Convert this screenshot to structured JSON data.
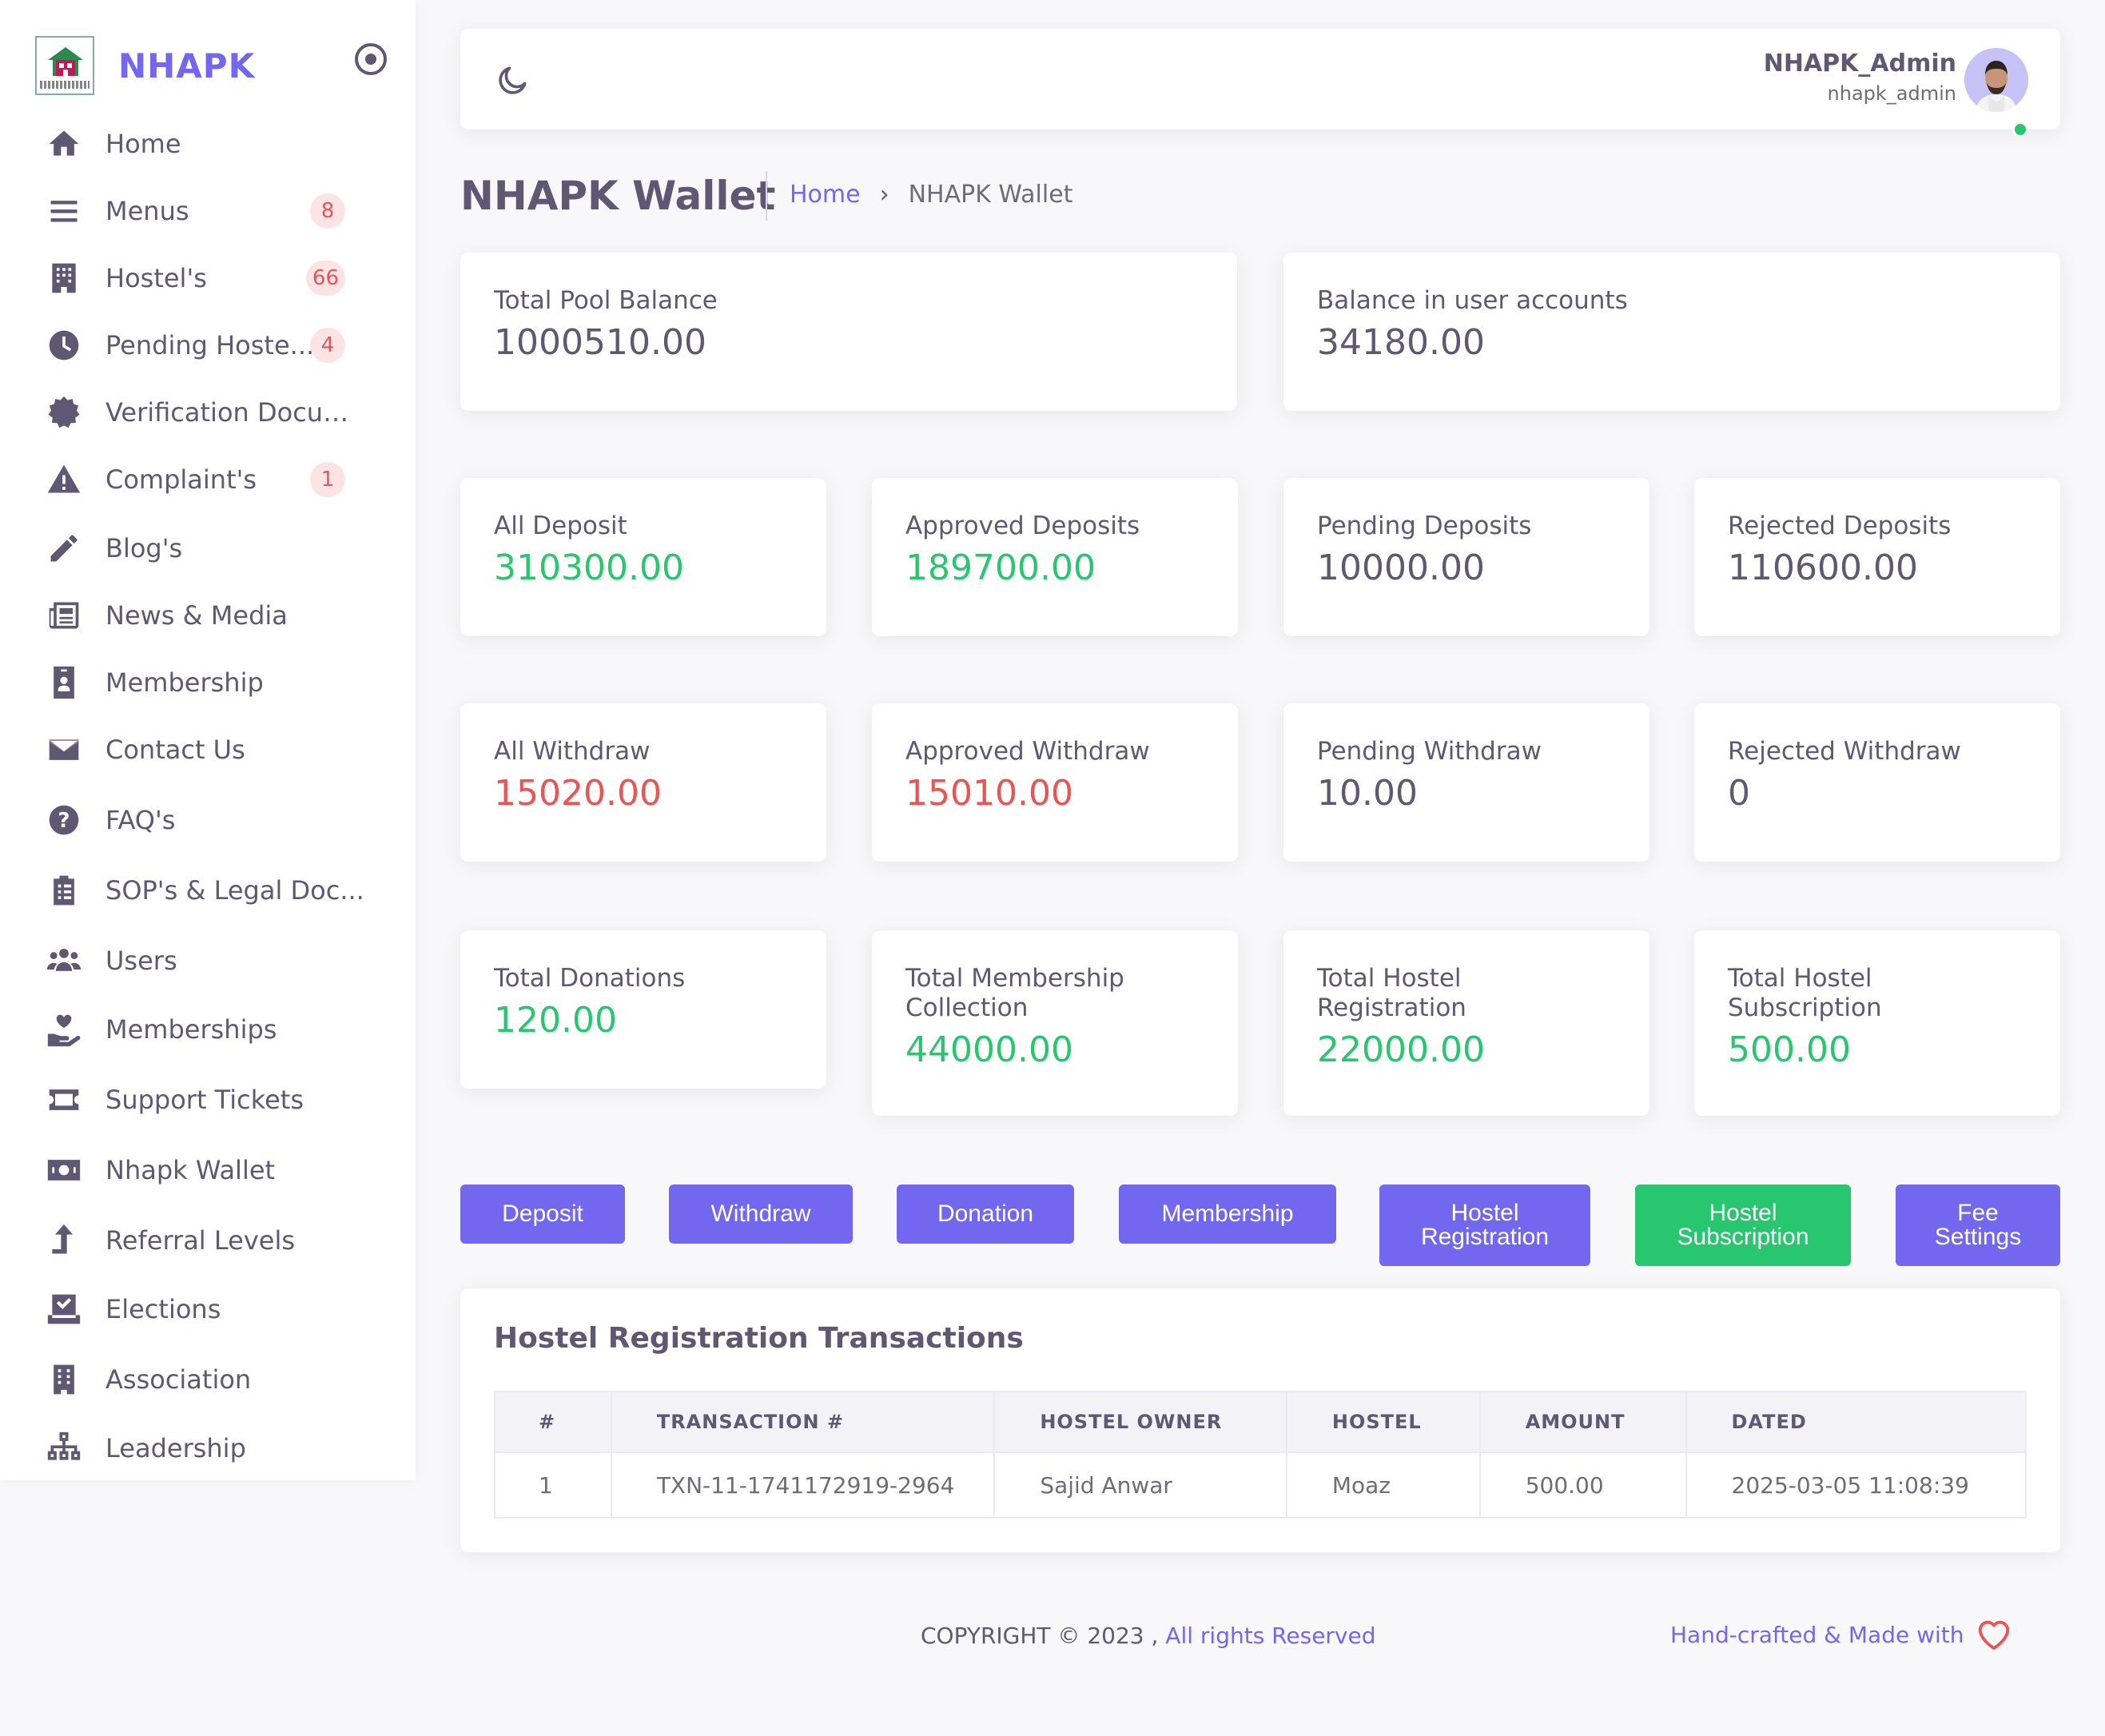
{
  "brand": {
    "name": "NHAPK"
  },
  "sidebar": {
    "items": [
      {
        "label": "Home",
        "icon": "home-icon"
      },
      {
        "label": "Menus",
        "icon": "menu-icon",
        "badge": "8"
      },
      {
        "label": "Hostel's",
        "icon": "building-icon",
        "badge": "66"
      },
      {
        "label": "Pending Hoste...",
        "icon": "clock-icon",
        "badge": "4"
      },
      {
        "label": "Verification Docum...",
        "icon": "certificate-icon"
      },
      {
        "label": "Complaint's",
        "icon": "warning-icon",
        "badge": "1"
      },
      {
        "label": "Blog's",
        "icon": "pencil-icon"
      },
      {
        "label": "News & Media",
        "icon": "newspaper-icon"
      },
      {
        "label": "Membership",
        "icon": "id-badge-icon"
      },
      {
        "label": "Contact Us",
        "icon": "envelope-icon"
      },
      {
        "label": "FAQ's",
        "icon": "question-circle-icon"
      },
      {
        "label": "SOP's & Legal Doc...",
        "icon": "clipboard-list-icon"
      },
      {
        "label": "Users",
        "icon": "users-icon"
      },
      {
        "label": "Memberships",
        "icon": "hand-heart-icon"
      },
      {
        "label": "Support Tickets",
        "icon": "ticket-icon"
      },
      {
        "label": "Nhapk Wallet",
        "icon": "money-bill-icon"
      },
      {
        "label": "Referral Levels",
        "icon": "level-up-icon"
      },
      {
        "label": "Elections",
        "icon": "vote-check-icon"
      },
      {
        "label": "Association",
        "icon": "office-building-icon"
      },
      {
        "label": "Leadership",
        "icon": "sitemap-icon"
      }
    ]
  },
  "navbar": {
    "user_name": "NHAPK_Admin",
    "user_role": "nhapk_admin"
  },
  "header": {
    "title": "NHAPK Wallet",
    "breadcrumb_home": "Home",
    "breadcrumb_current": "NHAPK Wallet"
  },
  "stats": {
    "total_pool_balance": {
      "label": "Total Pool Balance",
      "value": "1000510.00"
    },
    "balance_user_accounts": {
      "label": "Balance in user accounts",
      "value": "34180.00"
    },
    "all_deposit": {
      "label": "All Deposit",
      "value": "310300.00"
    },
    "approved_deposits": {
      "label": "Approved Deposits",
      "value": "189700.00"
    },
    "pending_deposits": {
      "label": "Pending Deposits",
      "value": "10000.00"
    },
    "rejected_deposits": {
      "label": "Rejected Deposits",
      "value": "110600.00"
    },
    "all_withdraw": {
      "label": "All Withdraw",
      "value": "15020.00"
    },
    "approved_withdraw": {
      "label": "Approved Withdraw",
      "value": "15010.00"
    },
    "pending_withdraw": {
      "label": "Pending Withdraw",
      "value": "10.00"
    },
    "rejected_withdraw": {
      "label": "Rejected Withdraw",
      "value": "0"
    },
    "total_donations": {
      "label": "Total Donations",
      "value": "120.00"
    },
    "total_membership_collection": {
      "label": "Total Membership Collection",
      "value": "44000.00"
    },
    "total_hostel_registration": {
      "label": "Total Hostel Registration",
      "value": "22000.00"
    },
    "total_hostel_subscription": {
      "label": "Total Hostel Subscription",
      "value": "500.00"
    }
  },
  "actions": {
    "deposit": "Deposit",
    "withdraw": "Withdraw",
    "donation": "Donation",
    "membership": "Membership",
    "hostel_registration_1": "Hostel",
    "hostel_registration_2": "Registration",
    "hostel_subscription_1": "Hostel",
    "hostel_subscription_2": "Subscription",
    "fee_settings_1": "Fee",
    "fee_settings_2": "Settings"
  },
  "transactions": {
    "title": "Hostel Registration Transactions",
    "columns": [
      "#",
      "TRANSACTION #",
      "HOSTEL OWNER",
      "HOSTEL",
      "AMOUNT",
      "DATED"
    ],
    "rows": [
      [
        "1",
        "TXN-11-1741172919-2964",
        "Sajid Anwar",
        "Moaz",
        "500.00",
        "2025-03-05 11:08:39"
      ]
    ]
  },
  "footer": {
    "copyright": "COPYRIGHT © 2023 ,",
    "rights": " All rights Reserved",
    "crafted": "Hand-crafted & Made with"
  },
  "colors": {
    "primary": "#7367f0",
    "success": "#28c76f",
    "danger": "#ea5455",
    "text": "#5e5873"
  }
}
